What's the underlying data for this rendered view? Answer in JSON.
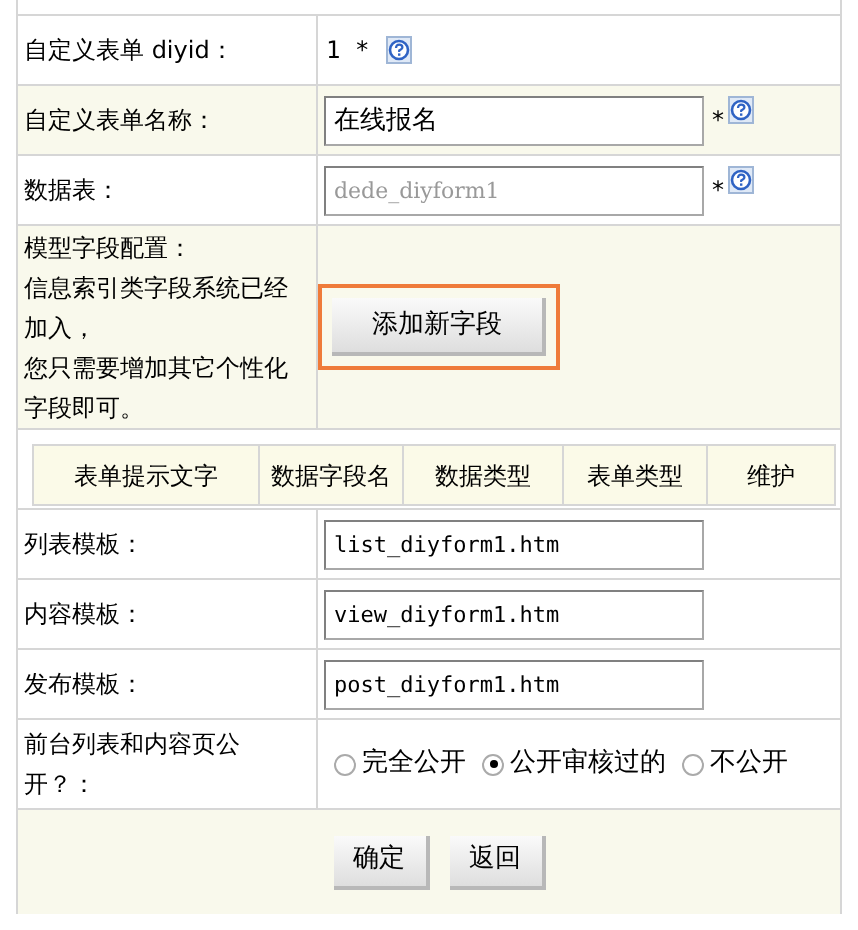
{
  "rows": [
    {
      "kind": "text",
      "label": "自定义表单 diyid：",
      "value": "1 *",
      "help": true
    },
    {
      "kind": "input",
      "label": "自定义表单名称：",
      "value": "在线报名",
      "required_mark": "*",
      "help": true
    },
    {
      "kind": "input",
      "label": "数据表：",
      "value": "dede_diyform1",
      "required_mark": "*",
      "help": true,
      "disabled": true
    },
    {
      "kind": "fields",
      "label_lines": [
        "模型字段配置：",
        "信息索引类字段系统已经加入，",
        "您只需要增加其它个性化字段即可。"
      ],
      "button": "添加新字段",
      "highlighted": true
    },
    {
      "kind": "table",
      "columns": [
        "表单提示文字",
        "数据字段名",
        "数据类型",
        "表单类型",
        "维护"
      ]
    },
    {
      "kind": "input",
      "label": "列表模板：",
      "value": "list_diyform1.htm"
    },
    {
      "kind": "input",
      "label": "内容模板：",
      "value": "view_diyform1.htm"
    },
    {
      "kind": "input",
      "label": "发布模板：",
      "value": "post_diyform1.htm"
    },
    {
      "kind": "radio",
      "label": "前台列表和内容页公开？：",
      "options": [
        {
          "label": "完全公开",
          "selected": false
        },
        {
          "label": "公开审核过的",
          "selected": true
        },
        {
          "label": "不公开",
          "selected": false
        }
      ]
    }
  ],
  "buttons": [
    "确定",
    "返回"
  ]
}
